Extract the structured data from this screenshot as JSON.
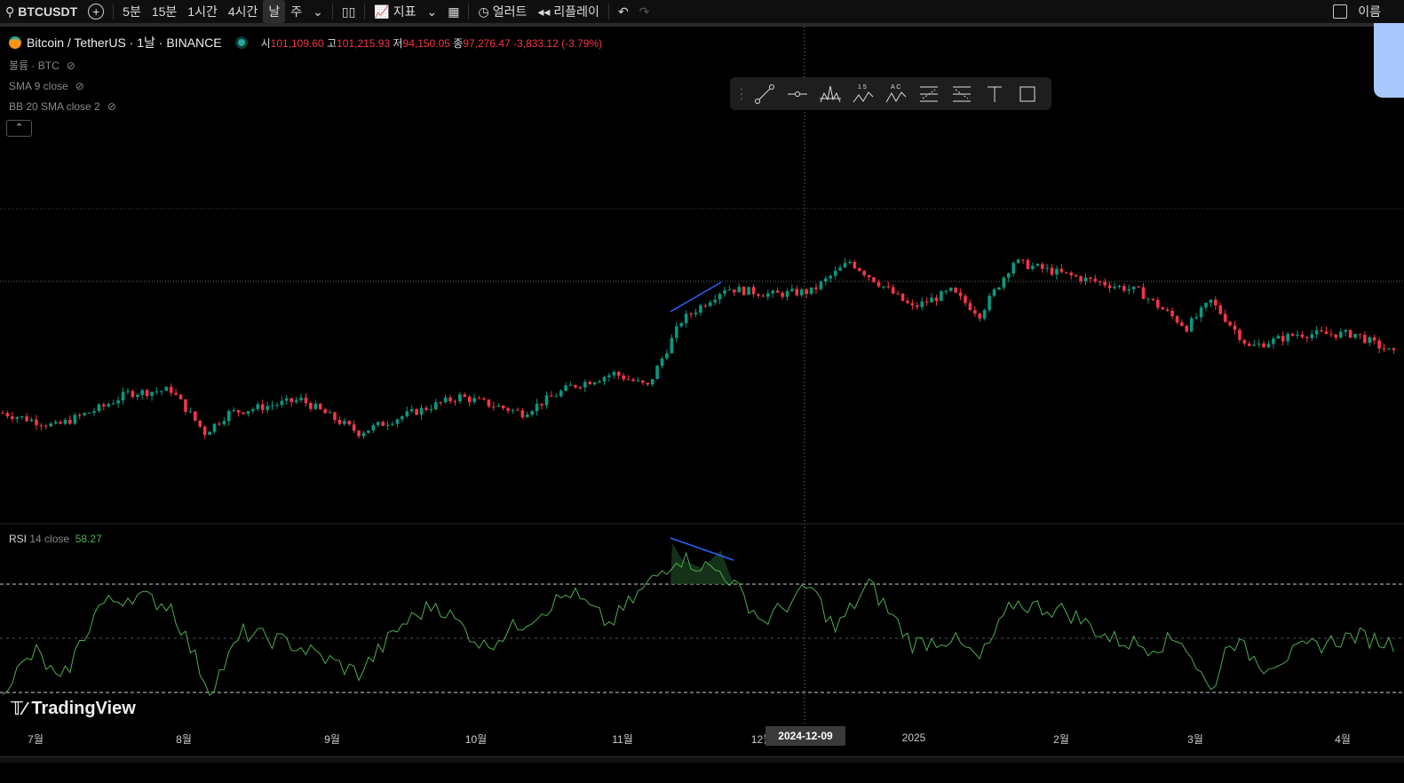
{
  "toolbar": {
    "symbol": "BTCUSDT",
    "intervals": [
      "5분",
      "15분",
      "1시간",
      "4시간",
      "날",
      "주"
    ],
    "selected_interval": "날",
    "indicators": "지표",
    "alert": "얼러트",
    "replay": "리플레이",
    "right_label": "이름"
  },
  "legend": {
    "title": "Bitcoin / TetherUS · 1날 · BINANCE",
    "o_label": "시",
    "o": "101,109.60",
    "h_label": "고",
    "h": "101,215.93",
    "l_label": "저",
    "l": "94,150.05",
    "c_label": "종",
    "c": "97,276.47",
    "change": "-3,833.12 (-3.79%)",
    "indicators": [
      "볼륨 · BTC",
      "SMA 9 close",
      "BB 20 SMA close 2"
    ]
  },
  "rsi": {
    "name": "RSI",
    "params": "14 close",
    "value": "58.27"
  },
  "branding": "TradingView",
  "colors": {
    "up": "#089981",
    "down": "#f23645",
    "rsi": "#4caf50",
    "trend": "#2962ff"
  },
  "chart_data": {
    "type": "candlestick",
    "x_ticks": [
      "7월",
      "8월",
      "9월",
      "10월",
      "11월",
      "12월",
      "2025",
      "2월",
      "3월",
      "4월"
    ],
    "crosshair_date": "2024-12-09",
    "price_keypoints": [
      [
        0,
        60000
      ],
      [
        11,
        56000
      ],
      [
        21,
        62000
      ],
      [
        26,
        66000
      ],
      [
        35,
        67000
      ],
      [
        42,
        54000
      ],
      [
        47,
        60000
      ],
      [
        62,
        64000
      ],
      [
        74,
        54000
      ],
      [
        83,
        59000
      ],
      [
        95,
        65000
      ],
      [
        108,
        60000
      ],
      [
        118,
        68000
      ],
      [
        127,
        72000
      ],
      [
        134,
        68000
      ],
      [
        141,
        88000
      ],
      [
        150,
        98000
      ],
      [
        160,
        96000
      ],
      [
        168,
        97000
      ],
      [
        176,
        106000
      ],
      [
        189,
        92000
      ],
      [
        197,
        97000
      ],
      [
        203,
        90000
      ],
      [
        210,
        106000
      ],
      [
        221,
        102000
      ],
      [
        236,
        97000
      ],
      [
        246,
        86000
      ],
      [
        251,
        94000
      ],
      [
        259,
        80000
      ],
      [
        269,
        84000
      ],
      [
        281,
        84000
      ],
      [
        289,
        78000
      ]
    ],
    "rsi_keypoints": [
      [
        0,
        32
      ],
      [
        7,
        45
      ],
      [
        12,
        33
      ],
      [
        20,
        62
      ],
      [
        27,
        66
      ],
      [
        35,
        62
      ],
      [
        43,
        31
      ],
      [
        50,
        52
      ],
      [
        60,
        48
      ],
      [
        74,
        37
      ],
      [
        83,
        55
      ],
      [
        90,
        63
      ],
      [
        100,
        47
      ],
      [
        110,
        58
      ],
      [
        118,
        67
      ],
      [
        126,
        55
      ],
      [
        133,
        68
      ],
      [
        140,
        80
      ],
      [
        150,
        74
      ],
      [
        158,
        56
      ],
      [
        168,
        69
      ],
      [
        173,
        53
      ],
      [
        180,
        70
      ],
      [
        189,
        48
      ],
      [
        197,
        50
      ],
      [
        203,
        42
      ],
      [
        210,
        63
      ],
      [
        221,
        60
      ],
      [
        230,
        50
      ],
      [
        238,
        47
      ],
      [
        245,
        50
      ],
      [
        251,
        30
      ],
      [
        255,
        50
      ],
      [
        262,
        40
      ],
      [
        272,
        47
      ],
      [
        281,
        51
      ],
      [
        289,
        48
      ]
    ],
    "rsi_levels": [
      70,
      50,
      30
    ]
  }
}
